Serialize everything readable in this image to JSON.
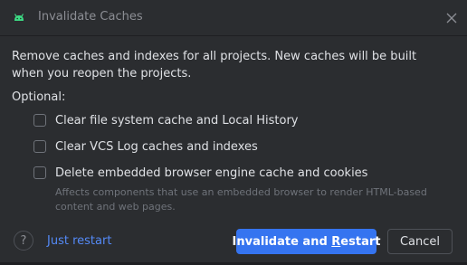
{
  "dialog": {
    "title": "Invalidate Caches",
    "app_icon": "android-icon",
    "close_icon": "close-icon"
  },
  "content": {
    "description": "Remove caches and indexes for all projects. New caches will be built when you reopen the projects.",
    "optional_label": "Optional:",
    "options": [
      {
        "label": "Clear file system cache and Local History",
        "checked": false
      },
      {
        "label": "Clear VCS Log caches and indexes",
        "checked": false
      },
      {
        "label": "Delete embedded browser engine cache and cookies",
        "checked": false
      }
    ],
    "browser_hint": "Affects components that use an embedded browser to render HTML-based content and web pages."
  },
  "footer": {
    "help_icon": "help-icon",
    "help_symbol": "?",
    "just_restart": "Just restart",
    "primary_prefix": "Invalidate and ",
    "primary_mnemonic": "R",
    "primary_suffix": "estart",
    "cancel": "Cancel"
  },
  "colors": {
    "background": "#2b2d30",
    "text": "#dfe1e5",
    "muted": "#6f737a",
    "link": "#548af7",
    "primary": "#3574f0",
    "android": "#3ddc84"
  }
}
